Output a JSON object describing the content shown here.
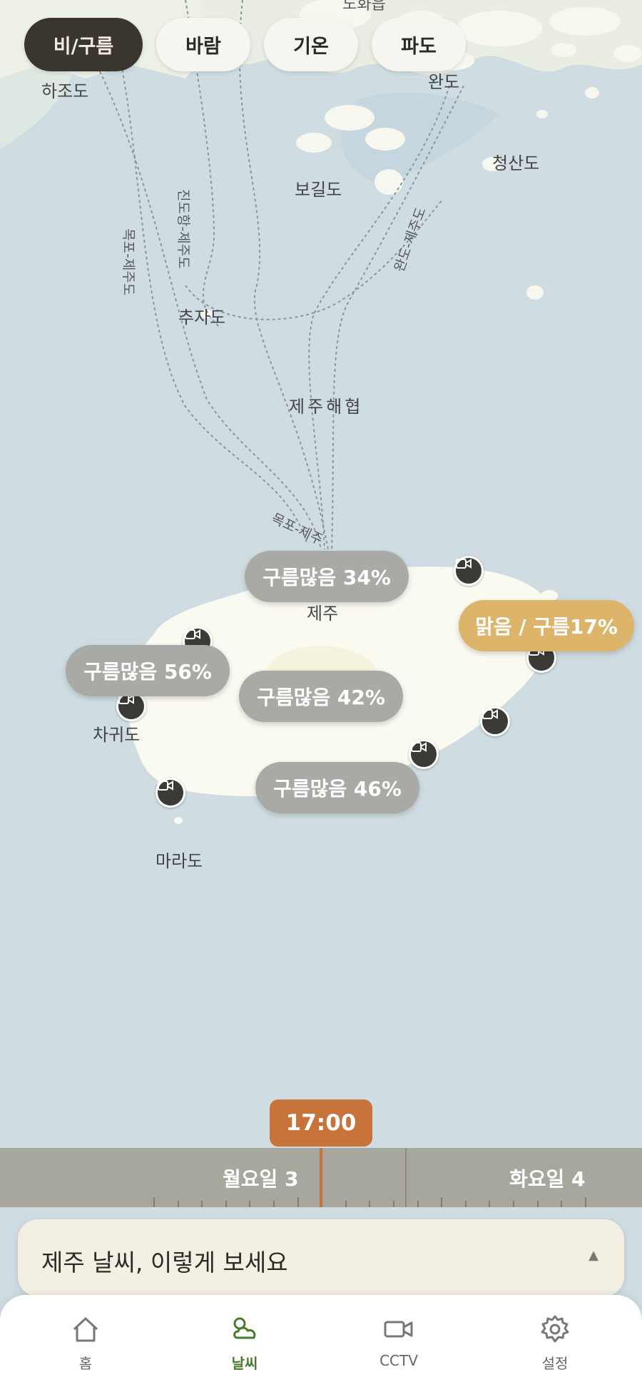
{
  "tabs": [
    {
      "label": "비/구름",
      "active": true
    },
    {
      "label": "바람",
      "active": false
    },
    {
      "label": "기온",
      "active": false
    },
    {
      "label": "파도",
      "active": false
    }
  ],
  "map": {
    "labels": {
      "hajodo": "하조도",
      "wando": "완도",
      "bogildo": "보길도",
      "cheongsando": "청산도",
      "chujado": "추자도",
      "jeju_strait": "제주해협",
      "jeju": "제주",
      "chagwido": "차귀도",
      "marado": "마라도",
      "top_partial": "노화읍"
    },
    "routes": {
      "mokpo_jeju_1": "목포-제주도",
      "jindo_jeju": "진도항-제주도",
      "wando_jeju": "완도-제주도",
      "mokpo_jeju_2": "목포-제주"
    }
  },
  "weather_bubbles": [
    {
      "label": "구름많음 34%",
      "type": "cloudy"
    },
    {
      "label": "맑음 / 구름17%",
      "type": "sunny"
    },
    {
      "label": "구름많음 56%",
      "type": "cloudy"
    },
    {
      "label": "구름많음 42%",
      "type": "cloudy"
    },
    {
      "label": "구름많음 46%",
      "type": "cloudy"
    }
  ],
  "timeline": {
    "current_time": "17:00",
    "days": [
      "월요일 3",
      "화요일 4"
    ]
  },
  "info_panel": {
    "text": "제주 날씨, 이렇게 보세요",
    "arrow": "▲"
  },
  "bottom_nav": [
    {
      "label": "홈",
      "icon": "home-icon",
      "active": false
    },
    {
      "label": "날씨",
      "icon": "weather-cloud-icon",
      "active": true
    },
    {
      "label": "CCTV",
      "icon": "video-camera-icon",
      "active": false
    },
    {
      "label": "설정",
      "icon": "settings-gear-icon",
      "active": false
    }
  ],
  "colors": {
    "sea": "#cfdde2",
    "land": "#fbfaf1",
    "active_tab": "#3b352f",
    "cloudy_bubble": "#a9aaa6",
    "sunny_bubble": "#dcb46a",
    "time_badge": "#c8733a",
    "nav_active": "#4a7a2b"
  }
}
